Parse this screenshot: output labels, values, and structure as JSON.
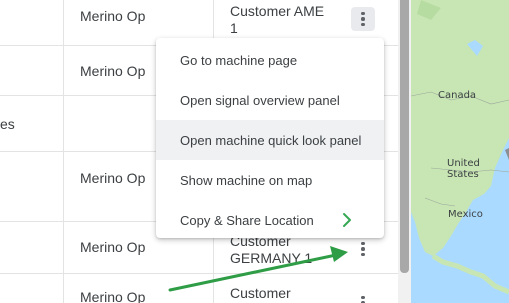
{
  "table": {
    "rows": [
      {
        "operator": "Merino Op",
        "customer_line1": "Customer AME",
        "customer_line2": "1"
      },
      {
        "operator": "Merino Op",
        "customer_line1": "",
        "customer_line2": ""
      },
      {
        "truncated_left": "es",
        "operator": "",
        "customer_line1": "",
        "customer_line2": ""
      },
      {
        "operator": "Merino Op",
        "customer_line1": "",
        "customer_line2": ""
      },
      {
        "operator": "Merino Op",
        "customer_line1": "Customer",
        "customer_line2": "GERMANY 1"
      },
      {
        "operator": "Merino Op",
        "customer_line1": "Customer",
        "customer_line2": ""
      }
    ]
  },
  "menu": {
    "items": [
      {
        "label": "Go to machine page"
      },
      {
        "label": "Open signal overview panel"
      },
      {
        "label": "Open machine quick look panel"
      },
      {
        "label": "Show machine on map"
      },
      {
        "label": "Copy & Share Location"
      }
    ]
  },
  "map": {
    "labels": {
      "canada": "Canada",
      "us": "United States",
      "mexico": "Mexico"
    }
  },
  "colors": {
    "arrow": "#2e9d46",
    "chevron": "#34a853",
    "water": "#aadaff",
    "land": "#c8e6b4"
  }
}
